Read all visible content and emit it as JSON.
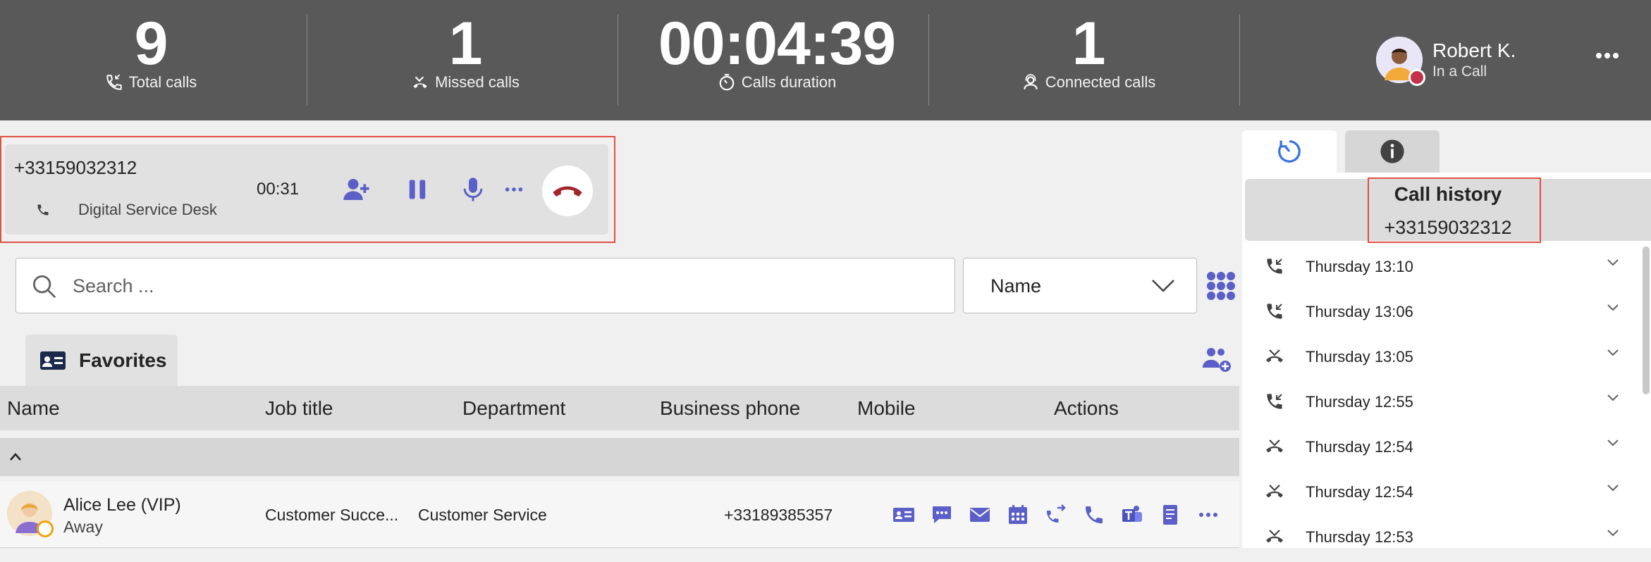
{
  "stats": {
    "total_calls": {
      "value": "9",
      "label": "Total calls",
      "icon": "phone-icon"
    },
    "missed_calls": {
      "value": "1",
      "label": "Missed calls",
      "icon": "missed-call-icon"
    },
    "calls_duration": {
      "value": "00:04:39",
      "label": "Calls duration",
      "icon": "timer-icon"
    },
    "connected_calls": {
      "value": "1",
      "label": "Connected calls",
      "icon": "headset-icon"
    }
  },
  "user": {
    "name": "Robert K.",
    "status": "In a Call"
  },
  "active_call": {
    "number": "+33159032312",
    "queue": "Digital Service Desk",
    "timer": "00:31"
  },
  "search": {
    "placeholder": "Search ..."
  },
  "sort_select": {
    "value": "Name"
  },
  "favorites_tab": {
    "label": "Favorites"
  },
  "table": {
    "headers": [
      "Name",
      "Job title",
      "Department",
      "Business phone",
      "Mobile",
      "Actions"
    ],
    "rows": [
      {
        "name": "Alice Lee (VIP)",
        "status": "Away",
        "job_title": "Customer Succe...",
        "department": "Customer Service",
        "business_phone": "+33189385357",
        "mobile": ""
      }
    ]
  },
  "call_history": {
    "title": "Call history",
    "number": "+33159032312",
    "items": [
      {
        "label": "Thursday 13:10",
        "type": "incoming"
      },
      {
        "label": "Thursday 13:06",
        "type": "incoming"
      },
      {
        "label": "Thursday 13:05",
        "type": "missed"
      },
      {
        "label": "Thursday 12:55",
        "type": "incoming"
      },
      {
        "label": "Thursday 12:54",
        "type": "missed"
      },
      {
        "label": "Thursday 12:54",
        "type": "missed"
      },
      {
        "label": "Thursday 12:53",
        "type": "missed"
      }
    ]
  },
  "colors": {
    "header_bg": "#595959",
    "accent": "#5b5fc7",
    "hangup": "#a4262c",
    "highlight_outline": "#e05043"
  }
}
